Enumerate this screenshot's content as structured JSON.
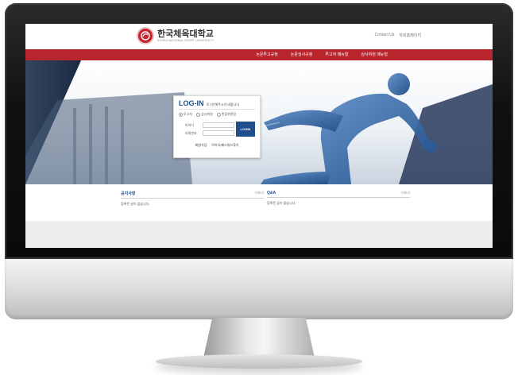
{
  "header": {
    "logo_korean": "한국체육대학교",
    "logo_english": "KOREA NATIONAL SPORT UNIVERSITY",
    "links": [
      "Contact Us",
      "학회홈페이지"
    ]
  },
  "nav": {
    "items": [
      "논문투고규정",
      "논문심사규정",
      "투고자 매뉴얼",
      "심사위원 매뉴얼"
    ]
  },
  "login": {
    "title": "LOG-IN",
    "subtitle": "로그인해주시기 바랍니다.",
    "tabs": [
      {
        "label": "투고자",
        "selected": true
      },
      {
        "label": "심사위원",
        "selected": false
      },
      {
        "label": "편집위원장",
        "selected": false
      }
    ],
    "id_label": "아이디",
    "pw_label": "비밀번호",
    "button": "LOGIN",
    "links": [
      "회원가입",
      "아이디/패스워드찾기"
    ]
  },
  "boards": {
    "notice": {
      "title": "공지사항",
      "more": "더보기",
      "empty": "등록된 글이 없습니다."
    },
    "qna": {
      "title": "Q&A",
      "more": "더보기",
      "empty": "등록된 글이 없습니다."
    }
  },
  "colors": {
    "brand_red": "#b8252d",
    "brand_blue": "#1f4e8a",
    "hero_bg": "#1b2d49"
  }
}
